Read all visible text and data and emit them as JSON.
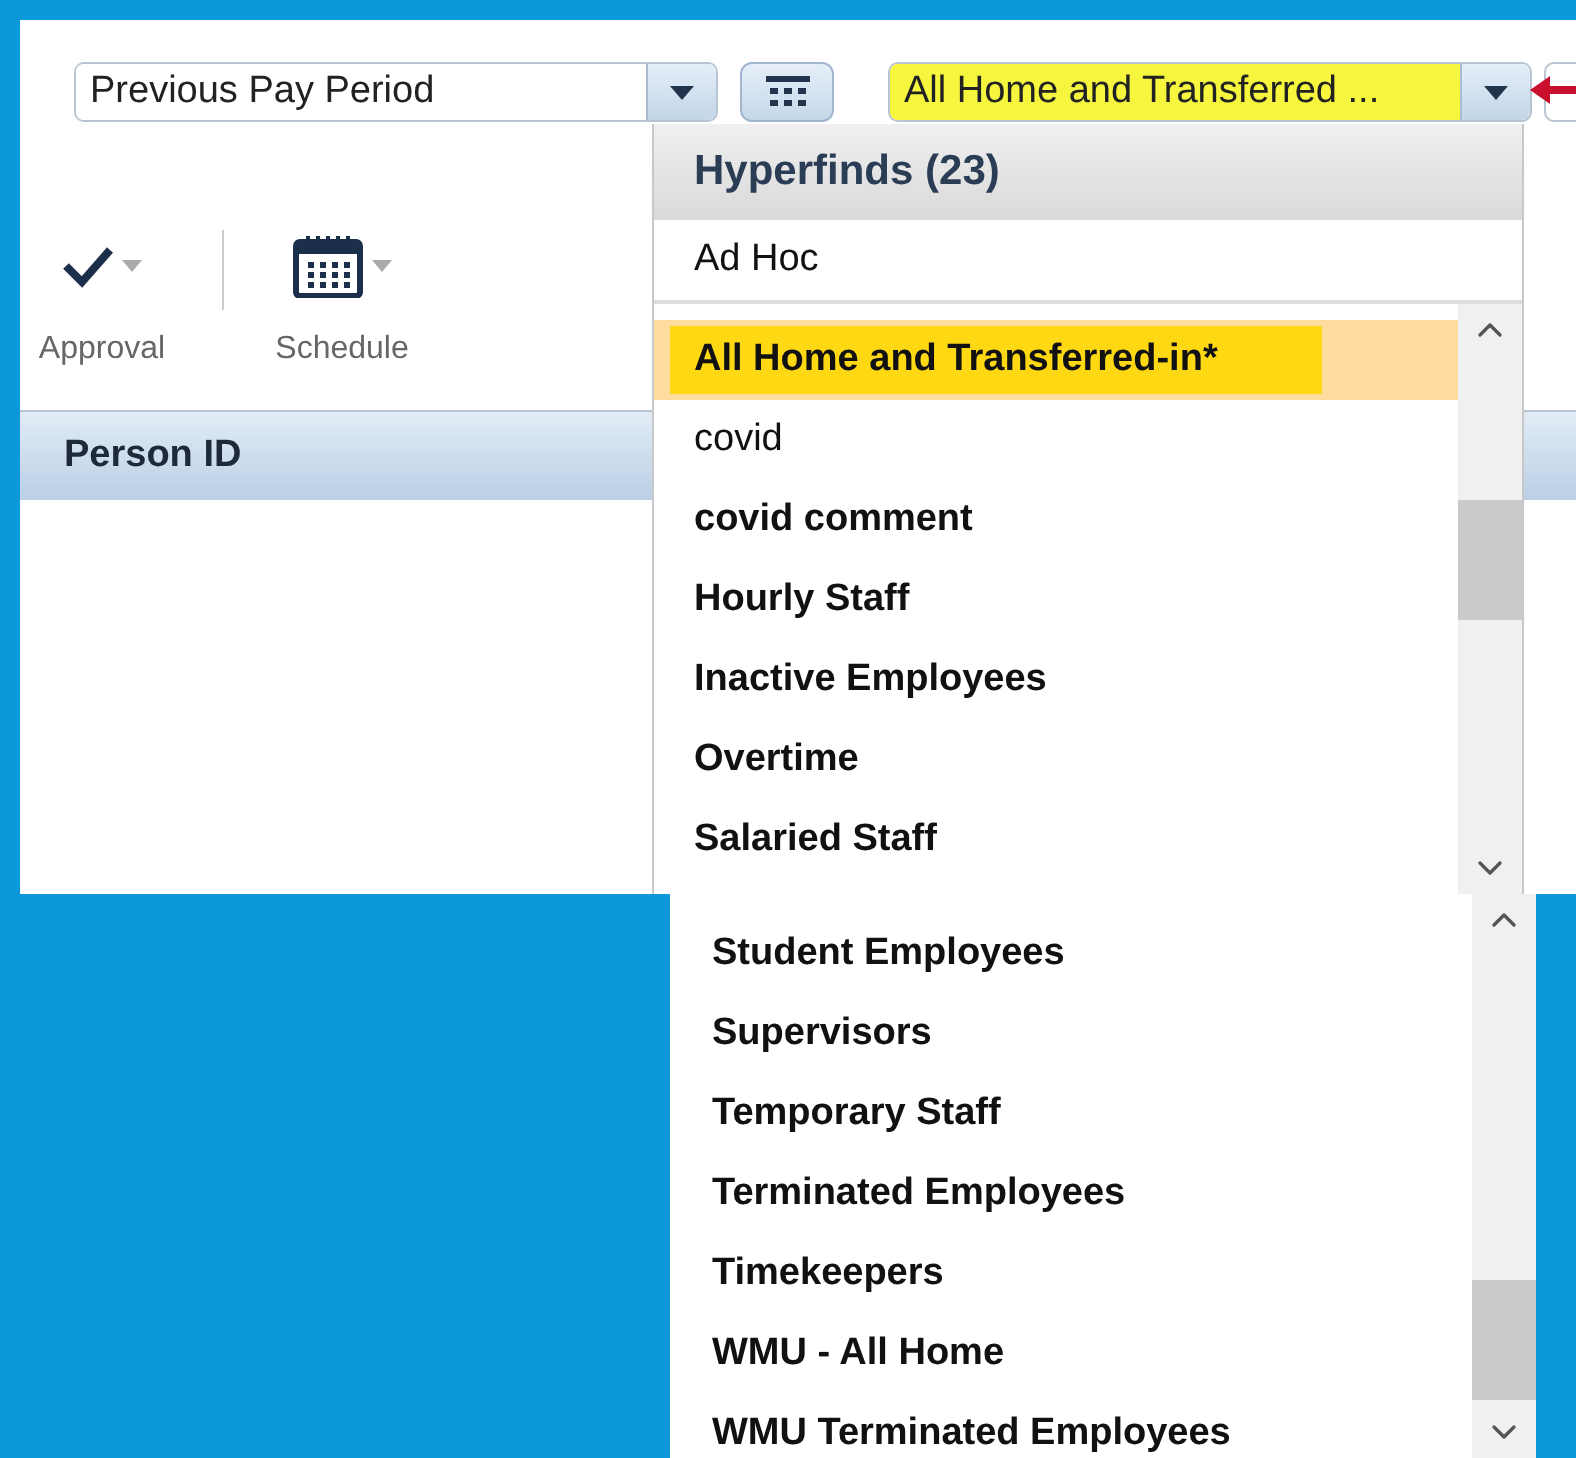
{
  "date_range": {
    "value": "Previous Pay Period"
  },
  "hyperfind": {
    "value": "All Home and Transferred ...",
    "highlighted": true
  },
  "toolbar": [
    {
      "label": "Approval",
      "kind": "check"
    },
    {
      "label": "Schedule",
      "kind": "calendar"
    }
  ],
  "table": {
    "columns": [
      "Person ID"
    ]
  },
  "hyperfinds_menu": {
    "title": "Hyperfinds (23)",
    "ad_hoc": "Ad Hoc",
    "items": [
      {
        "label": "All Home and Transferred-in*",
        "selected": true,
        "bold": true,
        "highlighted": true
      },
      {
        "label": "covid",
        "selected": false,
        "bold": false,
        "highlighted": false
      },
      {
        "label": "covid comment",
        "selected": false,
        "bold": true,
        "highlighted": false
      },
      {
        "label": "Hourly Staff",
        "selected": false,
        "bold": true,
        "highlighted": false
      },
      {
        "label": "Inactive Employees",
        "selected": false,
        "bold": true,
        "highlighted": false
      },
      {
        "label": "Overtime",
        "selected": false,
        "bold": true,
        "highlighted": false
      },
      {
        "label": "Salaried Staff",
        "selected": false,
        "bold": true,
        "highlighted": false
      }
    ]
  },
  "menu_continued": {
    "items": [
      {
        "label": "Student Employees",
        "selected": false,
        "bold": true,
        "highlighted": false
      },
      {
        "label": "Supervisors",
        "selected": false,
        "bold": true,
        "highlighted": false
      },
      {
        "label": "Temporary Staff",
        "selected": false,
        "bold": true,
        "highlighted": false
      },
      {
        "label": "Terminated Employees",
        "selected": false,
        "bold": true,
        "highlighted": false
      },
      {
        "label": "Timekeepers",
        "selected": false,
        "bold": true,
        "highlighted": false
      },
      {
        "label": "WMU - All Home",
        "selected": false,
        "bold": true,
        "highlighted": false
      },
      {
        "label": "WMU Terminated Employees",
        "selected": false,
        "bold": true,
        "highlighted": false
      }
    ]
  }
}
